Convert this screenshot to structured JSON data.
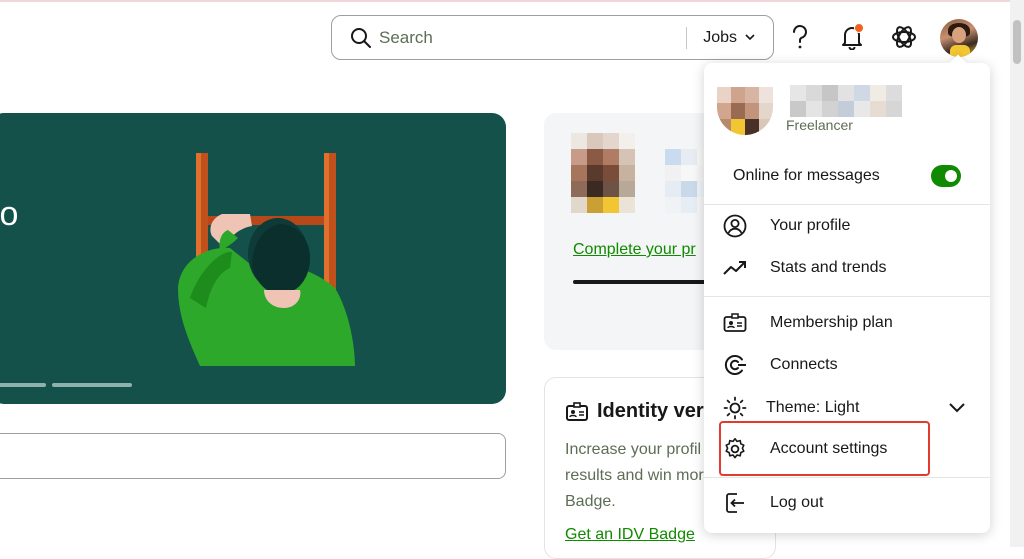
{
  "header": {
    "search_placeholder": "Search",
    "search_category": "Jobs",
    "icons": [
      "search-icon",
      "chevron-down-icon",
      "help-icon",
      "bell-icon",
      "apps-icon",
      "avatar"
    ],
    "notification_dot_color": "#f2611d"
  },
  "hero": {
    "text": "to",
    "background": "#14514a"
  },
  "profile_card": {
    "link": "Complete your pr"
  },
  "identity_card": {
    "title": "Identity ver",
    "description_lines": [
      "Increase your profil",
      "results and win mor",
      "Badge."
    ],
    "link": "Get an IDV Badge"
  },
  "menu": {
    "role": "Freelancer",
    "online_label": "Online for messages",
    "online_enabled": true,
    "items": [
      {
        "label": "Your profile",
        "icon": "user-circle-icon"
      },
      {
        "label": "Stats and trends",
        "icon": "trend-up-icon"
      },
      {
        "label": "Membership plan",
        "icon": "id-card-icon"
      },
      {
        "label": "Connects",
        "icon": "connects-icon"
      },
      {
        "label": "Theme: Light",
        "icon": "sun-icon"
      },
      {
        "label": "Account settings",
        "icon": "gear-icon"
      },
      {
        "label": "Log out",
        "icon": "logout-icon"
      }
    ],
    "highlighted_item": "Account settings",
    "highlight_color": "#e23b2e",
    "accent_color": "#108a00"
  }
}
